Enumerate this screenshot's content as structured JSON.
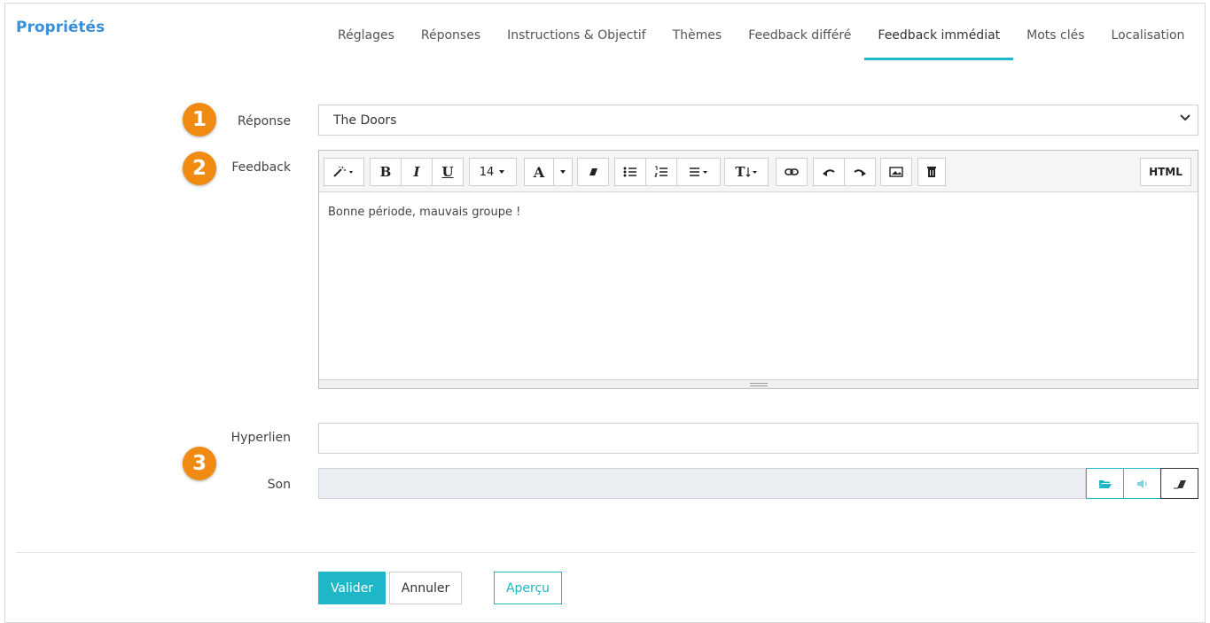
{
  "panel": {
    "title": "Propriétés"
  },
  "tabs": [
    {
      "label": "Réglages"
    },
    {
      "label": "Réponses"
    },
    {
      "label": "Instructions & Objectif"
    },
    {
      "label": "Thèmes"
    },
    {
      "label": "Feedback différé"
    },
    {
      "label": "Feedback immédiat"
    },
    {
      "label": "Mots clés"
    },
    {
      "label": "Localisation"
    }
  ],
  "active_tab": "Feedback immédiat",
  "form": {
    "response_label": "Réponse",
    "response_value": "The Doors",
    "feedback_label": "Feedback",
    "feedback_text": "Bonne période, mauvais groupe !",
    "hyperlink_label": "Hyperlien",
    "hyperlink_value": "",
    "sound_label": "Son"
  },
  "badges": [
    "1",
    "2",
    "3"
  ],
  "toolbar": {
    "font_size": "14",
    "bold": "B",
    "italic": "I",
    "underline": "U",
    "font_color": "A",
    "textsize": "T",
    "html": "HTML"
  },
  "buttons": {
    "validate": "Valider",
    "cancel": "Annuler",
    "preview": "Aperçu"
  },
  "colors": {
    "accent": "#1fb6c7",
    "title": "#3a8fd6",
    "badge": "#f08a10"
  }
}
